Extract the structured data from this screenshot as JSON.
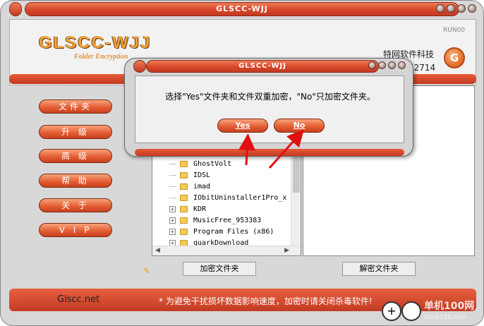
{
  "window": {
    "title": "GLSCC-WJJ",
    "logo_main": "GLSCC-WJJ",
    "logo_sub": "Folder Encryption",
    "run_label": "RUN00",
    "company_name": "特网软件科技",
    "company_number": "52714",
    "badge_letter": "G"
  },
  "sidebar": {
    "items": [
      {
        "label": "文件夹"
      },
      {
        "label": "升 级"
      },
      {
        "label": "高 级"
      },
      {
        "label": "帮 助"
      },
      {
        "label": "关 于"
      },
      {
        "label": "V I P"
      }
    ]
  },
  "tree": {
    "items": [
      {
        "label": "GhostVolt",
        "expandable": false
      },
      {
        "label": "IDSL",
        "expandable": false
      },
      {
        "label": "imad",
        "expandable": false
      },
      {
        "label": "IObitUninstaller1Pro_x",
        "expandable": false
      },
      {
        "label": "KDR",
        "expandable": true
      },
      {
        "label": "MusicFree_953383",
        "expandable": true
      },
      {
        "label": "Program Files (x86)",
        "expandable": true
      },
      {
        "label": "quarkDownload",
        "expandable": true
      }
    ],
    "scroll_left": "◀",
    "scroll_right": "▶"
  },
  "actions": {
    "encrypt_label": "加密文件夹",
    "decrypt_label": "解密文件夹"
  },
  "footer": {
    "site": "Glscc.net",
    "notice": "* 为避免干扰损坏数据影响速度，加密时请关闭杀毒软件!",
    "watermark": "单机100网",
    "watermark_sub": "danji100.com"
  },
  "dialog": {
    "title": "GLSCC-WJJ",
    "message": "选择\"Yes\"文件夹和文件双重加密，\"No\"只加密文件夹。",
    "yes_label": "Yes",
    "no_label": "No"
  },
  "colors": {
    "accent": "#d8462a",
    "arrow": "#e01010"
  }
}
